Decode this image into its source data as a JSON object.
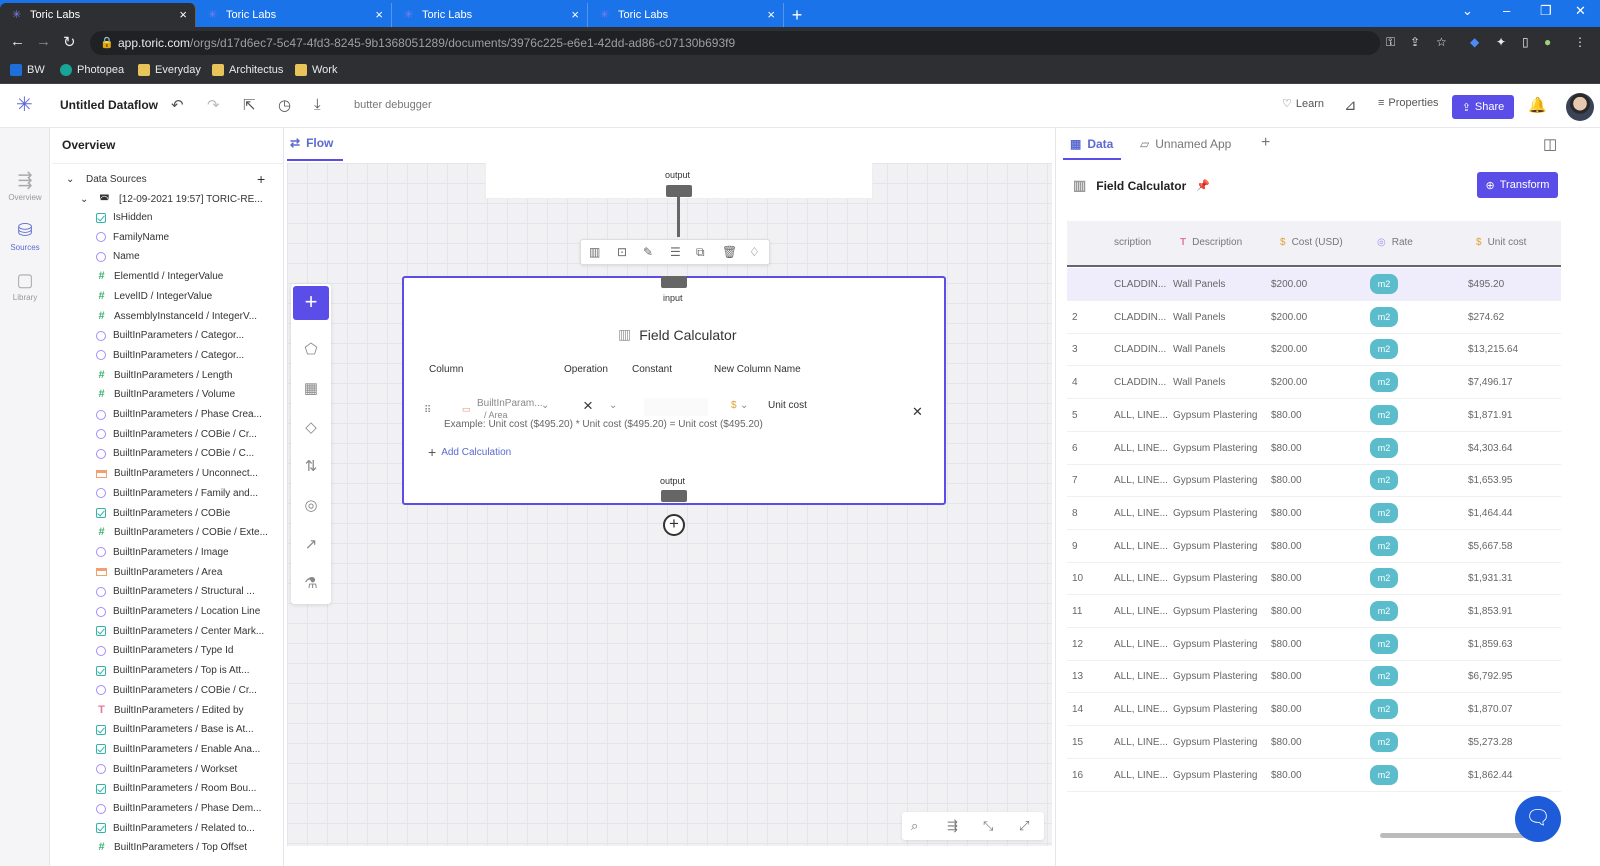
{
  "browser": {
    "tabs": [
      {
        "title": "Toric Labs",
        "active": true
      },
      {
        "title": "Toric Labs",
        "active": false
      },
      {
        "title": "Toric Labs",
        "active": false
      },
      {
        "title": "Toric Labs",
        "active": false
      }
    ],
    "url_host": "app.toric.com",
    "url_path": "/orgs/d17d6ec7-5c47-4fd3-8245-9b1368051289/documents/3976c225-e6e1-42dd-ad86-c07130b693f9",
    "bookmarks": [
      "BW",
      "Photopea",
      "Everyday",
      "Architectus",
      "Work"
    ],
    "colors": {
      "tabbar": "#1a73e8",
      "toolbar": "#2d2f33"
    }
  },
  "app": {
    "name": "Untitled Dataflow",
    "debug_label": "butter debugger",
    "learn_label": "Learn",
    "properties_label": "Properties",
    "share_label": "Share",
    "accent": "#5b4de8"
  },
  "rail": {
    "items": [
      {
        "label": "Overview",
        "icon": "overview-icon"
      },
      {
        "label": "Sources",
        "icon": "database-icon",
        "active": true
      },
      {
        "label": "Library",
        "icon": "library-icon"
      }
    ]
  },
  "overview": {
    "title": "Overview",
    "data_sources_label": "Data Sources",
    "source_name": "[12-09-2021 19:57] TORIC-RE...",
    "fields": [
      {
        "name": "IsHidden",
        "type": "bool"
      },
      {
        "name": "FamilyName",
        "type": "circle"
      },
      {
        "name": "Name",
        "type": "circle"
      },
      {
        "name": "ElementId / IntegerValue",
        "type": "number"
      },
      {
        "name": "LevelID / IntegerValue",
        "type": "number"
      },
      {
        "name": "AssemblyInstanceId / IntegerV...",
        "type": "number"
      },
      {
        "name": "BuiltInParameters / Categor...",
        "type": "circle"
      },
      {
        "name": "BuiltInParameters / Categor...",
        "type": "circle"
      },
      {
        "name": "BuiltInParameters / Length",
        "type": "number"
      },
      {
        "name": "BuiltInParameters / Volume",
        "type": "number"
      },
      {
        "name": "BuiltInParameters / Phase Crea...",
        "type": "circle"
      },
      {
        "name": "BuiltInParameters / COBie / Cr...",
        "type": "circle"
      },
      {
        "name": "BuiltInParameters / COBie / C...",
        "type": "circle"
      },
      {
        "name": "BuiltInParameters / Unconnect...",
        "type": "box"
      },
      {
        "name": "BuiltInParameters / Family and...",
        "type": "circle"
      },
      {
        "name": "BuiltInParameters / COBie",
        "type": "bool"
      },
      {
        "name": "BuiltInParameters / COBie / Exte...",
        "type": "number"
      },
      {
        "name": "BuiltInParameters / Image",
        "type": "circle"
      },
      {
        "name": "BuiltInParameters / Area",
        "type": "box"
      },
      {
        "name": "BuiltInParameters / Structural ...",
        "type": "circle"
      },
      {
        "name": "BuiltInParameters / Location Line",
        "type": "circle"
      },
      {
        "name": "BuiltInParameters / Center Mark...",
        "type": "bool"
      },
      {
        "name": "BuiltInParameters / Type Id",
        "type": "circle"
      },
      {
        "name": "BuiltInParameters / Top is Att...",
        "type": "bool"
      },
      {
        "name": "BuiltInParameters / COBie / Cr...",
        "type": "circle"
      },
      {
        "name": "BuiltInParameters / Edited by",
        "type": "text"
      },
      {
        "name": "BuiltInParameters / Base is At...",
        "type": "bool"
      },
      {
        "name": "BuiltInParameters / Enable Ana...",
        "type": "bool"
      },
      {
        "name": "BuiltInParameters / Workset",
        "type": "circle"
      },
      {
        "name": "BuiltInParameters / Room Bou...",
        "type": "bool"
      },
      {
        "name": "BuiltInParameters / Phase Dem...",
        "type": "circle"
      },
      {
        "name": "BuiltInParameters / Related to...",
        "type": "bool"
      },
      {
        "name": "BuiltInParameters / Top Offset",
        "type": "number"
      }
    ]
  },
  "flow": {
    "tab_label": "Flow",
    "top_port_label": "output",
    "input_label": "input",
    "output_label": "output",
    "node": {
      "title": "Field Calculator",
      "columns": [
        "Column",
        "Operation",
        "Constant",
        "New Column Name"
      ],
      "row": {
        "column_value": "BuiltInParam...",
        "column_value_line2": "/ Area",
        "operation_symbol": "×",
        "constant_prefix": "$",
        "new_column_name": "Unit cost"
      },
      "example": "Example: Unit cost ($495.20) * Unit cost ($495.20) = Unit cost ($495.20)",
      "add_calc_label": "Add Calculation"
    }
  },
  "data_panel": {
    "tabs": [
      {
        "label": "Data",
        "active": true
      },
      {
        "label": "Unnamed App",
        "active": false
      }
    ],
    "title": "Field Calculator",
    "transform_label": "Transform",
    "columns": [
      {
        "label": "scription",
        "icon": ""
      },
      {
        "label": "Description",
        "icon": "T"
      },
      {
        "label": "Cost (USD)",
        "icon": "$"
      },
      {
        "label": "Rate",
        "icon": "circle"
      },
      {
        "label": "Unit cost",
        "icon": "$"
      }
    ],
    "rows": [
      {
        "n": "",
        "a": "CLADDIN...",
        "desc": "Wall Panels",
        "cost": "$200.00",
        "rate": "m2",
        "unit": "$495.20"
      },
      {
        "n": "2",
        "a": "CLADDIN...",
        "desc": "Wall Panels",
        "cost": "$200.00",
        "rate": "m2",
        "unit": "$274.62"
      },
      {
        "n": "3",
        "a": "CLADDIN...",
        "desc": "Wall Panels",
        "cost": "$200.00",
        "rate": "m2",
        "unit": "$13,215.64"
      },
      {
        "n": "4",
        "a": "CLADDIN...",
        "desc": "Wall Panels",
        "cost": "$200.00",
        "rate": "m2",
        "unit": "$7,496.17"
      },
      {
        "n": "5",
        "a": "ALL, LINE...",
        "desc": "Gypsum Plastering",
        "cost": "$80.00",
        "rate": "m2",
        "unit": "$1,871.91"
      },
      {
        "n": "6",
        "a": "ALL, LINE...",
        "desc": "Gypsum Plastering",
        "cost": "$80.00",
        "rate": "m2",
        "unit": "$4,303.64"
      },
      {
        "n": "7",
        "a": "ALL, LINE...",
        "desc": "Gypsum Plastering",
        "cost": "$80.00",
        "rate": "m2",
        "unit": "$1,653.95"
      },
      {
        "n": "8",
        "a": "ALL, LINE...",
        "desc": "Gypsum Plastering",
        "cost": "$80.00",
        "rate": "m2",
        "unit": "$1,464.44"
      },
      {
        "n": "9",
        "a": "ALL, LINE...",
        "desc": "Gypsum Plastering",
        "cost": "$80.00",
        "rate": "m2",
        "unit": "$5,667.58"
      },
      {
        "n": "10",
        "a": "ALL, LINE...",
        "desc": "Gypsum Plastering",
        "cost": "$80.00",
        "rate": "m2",
        "unit": "$1,931.31"
      },
      {
        "n": "11",
        "a": "ALL, LINE...",
        "desc": "Gypsum Plastering",
        "cost": "$80.00",
        "rate": "m2",
        "unit": "$1,853.91"
      },
      {
        "n": "12",
        "a": "ALL, LINE...",
        "desc": "Gypsum Plastering",
        "cost": "$80.00",
        "rate": "m2",
        "unit": "$1,859.63"
      },
      {
        "n": "13",
        "a": "ALL, LINE...",
        "desc": "Gypsum Plastering",
        "cost": "$80.00",
        "rate": "m2",
        "unit": "$6,792.95"
      },
      {
        "n": "14",
        "a": "ALL, LINE...",
        "desc": "Gypsum Plastering",
        "cost": "$80.00",
        "rate": "m2",
        "unit": "$1,870.07"
      },
      {
        "n": "15",
        "a": "ALL, LINE...",
        "desc": "Gypsum Plastering",
        "cost": "$80.00",
        "rate": "m2",
        "unit": "$5,273.28"
      },
      {
        "n": "16",
        "a": "ALL, LINE...",
        "desc": "Gypsum Plastering",
        "cost": "$80.00",
        "rate": "m2",
        "unit": "$1,862.44"
      }
    ]
  }
}
